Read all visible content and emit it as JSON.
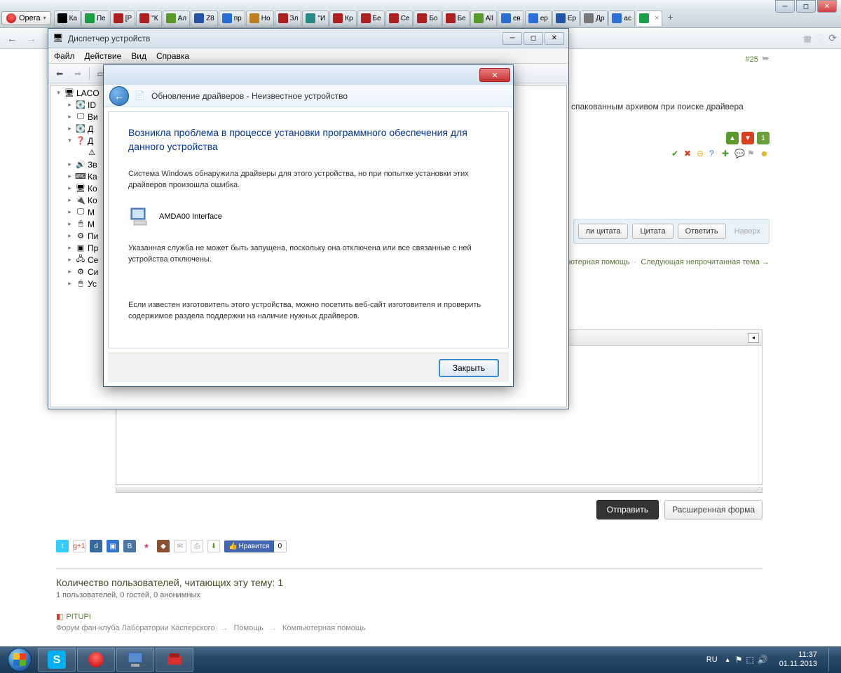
{
  "browser": {
    "name": "Opera",
    "tabs": [
      {
        "label": "Ка",
        "fav_color": "#000"
      },
      {
        "label": "Пе",
        "fav_color": "#1a9e46"
      },
      {
        "label": "[P",
        "fav_color": "#b02020"
      },
      {
        "label": "\"К",
        "fav_color": "#b02020"
      },
      {
        "label": "Ал",
        "fav_color": "#5a9a2a"
      },
      {
        "label": "Z8",
        "fav_color": "#2255aa"
      },
      {
        "label": "пр",
        "fav_color": "#2a70d8"
      },
      {
        "label": "Но",
        "fav_color": "#c08020"
      },
      {
        "label": "Зл",
        "fav_color": "#b02020"
      },
      {
        "label": "\"И",
        "fav_color": "#2a8a8a"
      },
      {
        "label": "Кр",
        "fav_color": "#b02020"
      },
      {
        "label": "Бе",
        "fav_color": "#b02020"
      },
      {
        "label": "Се",
        "fav_color": "#b02020"
      },
      {
        "label": "Бо",
        "fav_color": "#b02020"
      },
      {
        "label": "Бе",
        "fav_color": "#b02020"
      },
      {
        "label": "All",
        "fav_color": "#5a9a2a"
      },
      {
        "label": "ев",
        "fav_color": "#2a70d8"
      },
      {
        "label": "ер",
        "fav_color": "#2a70d8"
      },
      {
        "label": "Ер",
        "fav_color": "#2255aa"
      },
      {
        "label": "Др",
        "fav_color": "#777"
      },
      {
        "label": "ас",
        "fav_color": "#2a70d8"
      },
      {
        "label": "",
        "fav_color": "#1a9e46",
        "active": true,
        "close": "×"
      }
    ]
  },
  "forum": {
    "post_num": "#25",
    "excerpt": "спакованным архивом при поиске драйвера",
    "vote_count": "1",
    "reply_multi": "ли цитата",
    "reply_quote": "Цитата",
    "reply_answer": "Ответить",
    "reply_top": "Наверх",
    "crumb_section": "ьютерная помощь",
    "crumb_next": "Следующая непрочитанная тема →",
    "send": "Отправить",
    "advanced": "Расширенная форма",
    "fb_like": "Нравится",
    "fb_count": "0",
    "readers_title": "Количество пользователей, читающих эту тему: 1",
    "readers_sub": "1 пользователей, 0 гостей, 0 анонимных",
    "reader_name": "PITUPI",
    "bcrumb1": "Форум фан-клуба Лаборатории Касперского",
    "bcrumb2": "Помощь",
    "bcrumb3": "Компьютерная помощь"
  },
  "devmgr": {
    "title": "Диспетчер устройств",
    "menu": [
      "Файл",
      "Действие",
      "Вид",
      "Справка"
    ],
    "tree": [
      {
        "level": 1,
        "exp": "▾",
        "label": "LACO",
        "icon": "pc"
      },
      {
        "level": 2,
        "exp": "▸",
        "label": "ID",
        "icon": "disk"
      },
      {
        "level": 2,
        "exp": "▸",
        "label": "Ви",
        "icon": "display"
      },
      {
        "level": 2,
        "exp": "▸",
        "label": "Д",
        "icon": "disk"
      },
      {
        "level": 2,
        "exp": "▾",
        "label": "Д",
        "icon": "other"
      },
      {
        "level": 3,
        "exp": "",
        "label": "",
        "icon": "unknown"
      },
      {
        "level": 2,
        "exp": "▸",
        "label": "Зв",
        "icon": "sound"
      },
      {
        "level": 2,
        "exp": "▸",
        "label": "Ка",
        "icon": "keyboard"
      },
      {
        "level": 2,
        "exp": "▸",
        "label": "Ко",
        "icon": "pc"
      },
      {
        "level": 2,
        "exp": "▸",
        "label": "Ко",
        "icon": "usb"
      },
      {
        "level": 2,
        "exp": "▸",
        "label": "М",
        "icon": "monitor"
      },
      {
        "level": 2,
        "exp": "▸",
        "label": "М",
        "icon": "mouse"
      },
      {
        "level": 2,
        "exp": "▸",
        "label": "Пи",
        "icon": "port"
      },
      {
        "level": 2,
        "exp": "▸",
        "label": "Пр",
        "icon": "cpu"
      },
      {
        "level": 2,
        "exp": "▸",
        "label": "Се",
        "icon": "net"
      },
      {
        "level": 2,
        "exp": "▸",
        "label": "Си",
        "icon": "sys"
      },
      {
        "level": 2,
        "exp": "▸",
        "label": "Ус",
        "icon": "hid"
      }
    ]
  },
  "dialog": {
    "header": "Обновление драйверов - Неизвестное устройство",
    "title": "Возникла проблема в процессе установки программного обеспечения для данного устройства",
    "p1": "Система Windows обнаружила драйверы для этого устройства, но при попытке установки этих драйверов произошла ошибка.",
    "device": "AMDA00 Interface",
    "p2": "Указанная служба не может быть запущена, поскольку она отключена или все связанные с ней устройства отключены.",
    "p3": "Если известен изготовитель этого устройства, можно посетить веб-сайт изготовителя и проверить содержимое раздела поддержки на наличие нужных драйверов.",
    "close_btn": "Закрыть"
  },
  "taskbar": {
    "lang": "RU",
    "time": "11:37",
    "date": "01.11.2013"
  }
}
